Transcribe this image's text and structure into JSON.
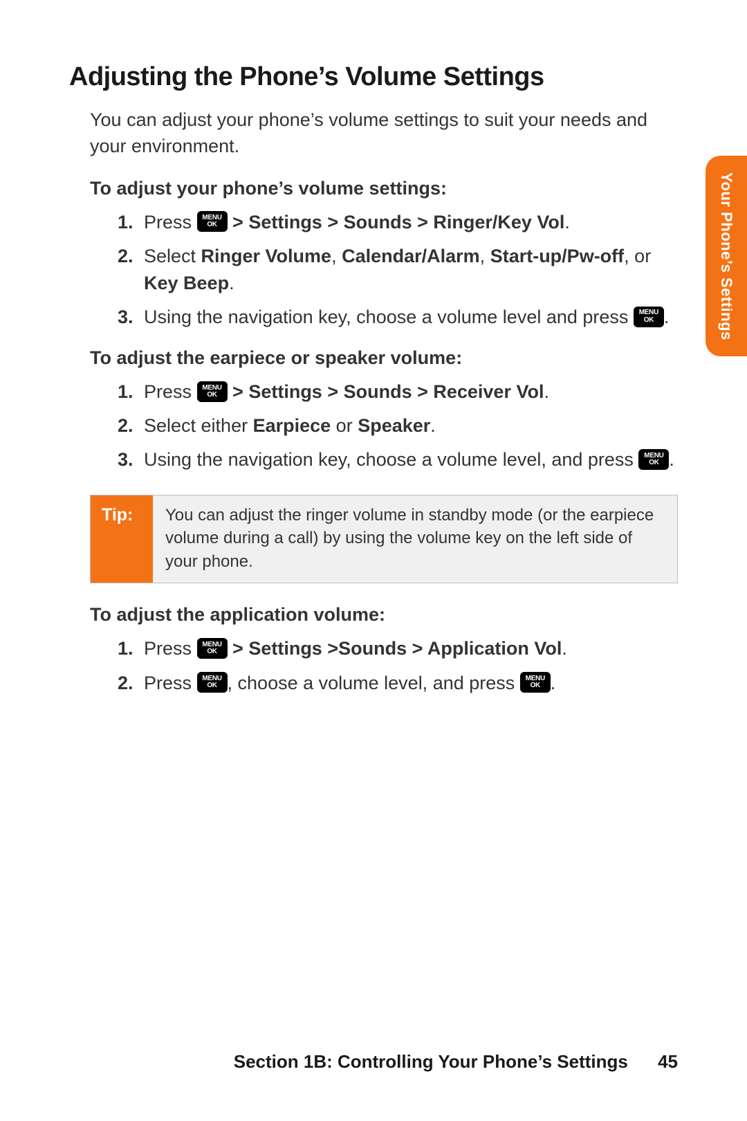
{
  "title": "Adjusting the Phone’s Volume Settings",
  "intro": "You can adjust your phone’s volume settings to suit your needs and your environment.",
  "side_tab": "Your Phone’s Settings",
  "key_icon": {
    "line1": "MENU",
    "line2": "OK"
  },
  "sec1": {
    "heading": "To adjust your phone’s volume settings:",
    "steps": {
      "s1_pre": "Press ",
      "s1_bold": " > Settings > Sounds > Ringer/Key Vol",
      "s1_post": ".",
      "s2_pre": "Select ",
      "s2_b1": "Ringer Volume",
      "s2_t1": ", ",
      "s2_b2": "Calendar/Alarm",
      "s2_t2": ", ",
      "s2_b3": "Start-up/Pw-off",
      "s2_t3": ", or ",
      "s2_b4": "Key Beep",
      "s2_post": ".",
      "s3_pre": "Using the navigation key, choose a volume level and press ",
      "s3_post": "."
    }
  },
  "sec2": {
    "heading": "To adjust the earpiece or speaker volume:",
    "steps": {
      "s1_pre": "Press ",
      "s1_bold": " > Settings > Sounds > Receiver Vol",
      "s1_post": ".",
      "s2_pre": "Select either ",
      "s2_b1": "Earpiece",
      "s2_t1": " or ",
      "s2_b2": "Speaker",
      "s2_post": ".",
      "s3_pre": "Using the navigation key, choose a volume level, and press ",
      "s3_post": "."
    }
  },
  "tip": {
    "label": "Tip:",
    "text": "You can adjust the ringer volume in standby mode (or the earpiece volume during a call) by using the volume key on the left side of your phone."
  },
  "sec3": {
    "heading": "To adjust the application volume:",
    "steps": {
      "s1_pre": "Press ",
      "s1_bold": " > Settings >Sounds > Application Vol",
      "s1_post": ".",
      "s2_pre": "Press ",
      "s2_mid": ", choose a volume level, and press ",
      "s2_post": "."
    }
  },
  "footer": {
    "section": "Section 1B: Controlling Your Phone’s Settings",
    "page": "45"
  }
}
